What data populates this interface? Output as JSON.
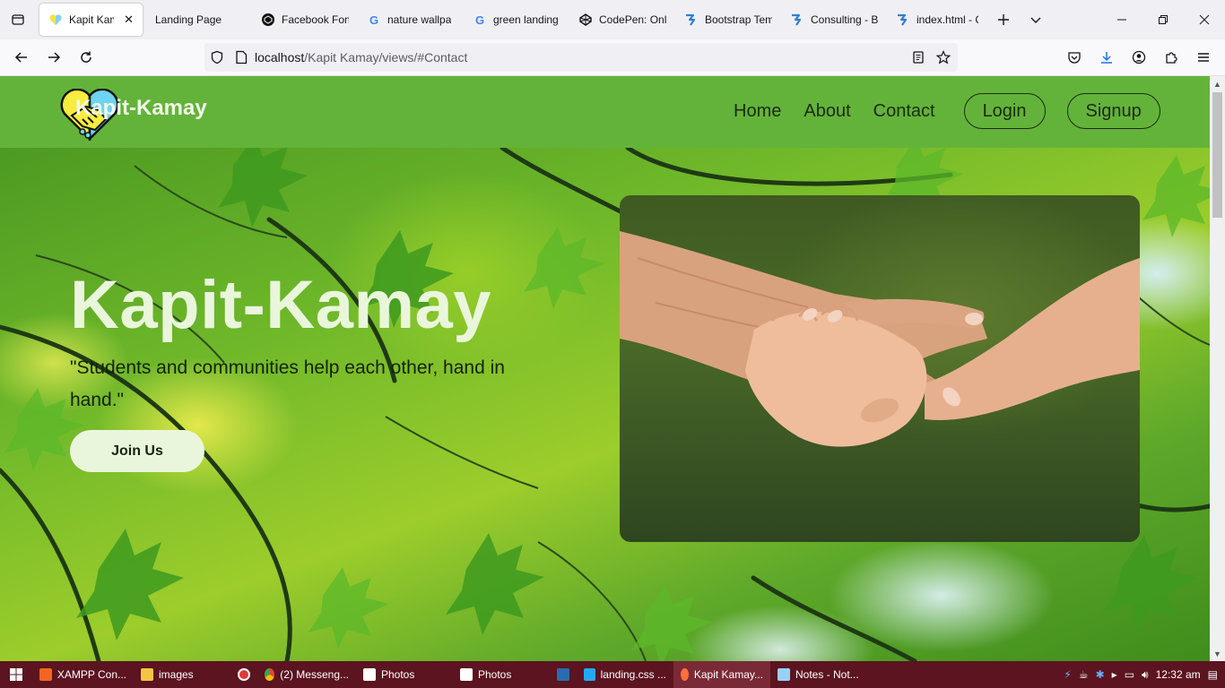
{
  "browser": {
    "tabs": [
      {
        "label": "Kapit Kama",
        "icon": "handshake-heart-icon",
        "active": true
      },
      {
        "label": "Landing Page",
        "icon": "blank-page-icon"
      },
      {
        "label": "Facebook Fon",
        "icon": "codepen-icon"
      },
      {
        "label": "nature wallpa",
        "icon": "google-icon"
      },
      {
        "label": "green landing",
        "icon": "google-icon"
      },
      {
        "label": "CodePen: Onli",
        "icon": "codepen-icon"
      },
      {
        "label": "Bootstrap Tem",
        "icon": "bootstrapmade-icon"
      },
      {
        "label": "Consulting - B",
        "icon": "bootstrapmade-icon"
      },
      {
        "label": "index.html - C",
        "icon": "bootstrapmade-icon"
      }
    ],
    "url_host": "localhost",
    "url_path": "/Kapit Kamay/views/#Contact"
  },
  "site": {
    "brand": "Kapit-Kamay",
    "nav": {
      "home": "Home",
      "about": "About",
      "contact": "Contact",
      "login": "Login",
      "signup": "Signup"
    },
    "hero": {
      "title": "Kapit-Kamay",
      "quote": "\"Students and communities help each other, hand in hand.\"",
      "cta": "Join Us"
    },
    "colors": {
      "header": "#63b33a",
      "hero_text": "#eaf6dc",
      "dark_text": "#1e2a14"
    }
  },
  "taskbar": {
    "items": [
      {
        "label": "XAMPP Con...",
        "icon": "xampp-icon",
        "color": "#f26522"
      },
      {
        "label": "images",
        "icon": "folder-icon",
        "color": "#f4c542"
      },
      {
        "label": "",
        "icon": "record-icon",
        "color": "#e03a3a"
      },
      {
        "label": "(2) Messeng...",
        "icon": "chrome-icon",
        "color": "#4285f4"
      },
      {
        "label": "Photos",
        "icon": "photos-icon",
        "color": "#ffffff"
      },
      {
        "label": "Photos",
        "icon": "photos-icon",
        "color": "#ffffff"
      },
      {
        "label": "",
        "icon": "terminal-icon",
        "color": "#2b6cb0"
      },
      {
        "label": "landing.css ...",
        "icon": "vscode-icon",
        "color": "#23a9f2"
      },
      {
        "label": "Kapit Kamay...",
        "icon": "firefox-icon",
        "color": "#ff7139",
        "active": true
      },
      {
        "label": "Notes - Not...",
        "icon": "notepad-icon",
        "color": "#9ad0f5"
      }
    ],
    "clock": "12:32 am"
  }
}
